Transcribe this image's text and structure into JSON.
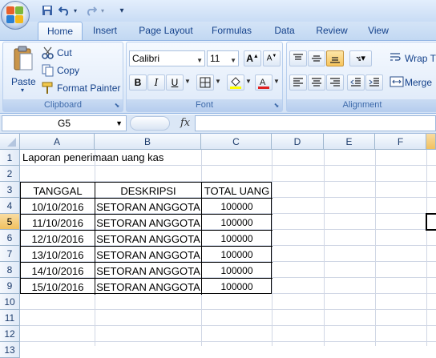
{
  "qat": {
    "save_icon": "save-icon",
    "undo_icon": "undo-icon",
    "redo_icon": "redo-icon",
    "customize_icon": "customize-qat-icon"
  },
  "tabs": [
    "Home",
    "Insert",
    "Page Layout",
    "Formulas",
    "Data",
    "Review",
    "View"
  ],
  "ribbon": {
    "clipboard": {
      "label": "Clipboard",
      "paste": "Paste",
      "cut": "Cut",
      "copy": "Copy",
      "format_painter": "Format Painter"
    },
    "font": {
      "label": "Font",
      "font_name": "Calibri",
      "font_size": "11",
      "bold": "B",
      "italic": "I",
      "underline": "U"
    },
    "alignment": {
      "label": "Alignment",
      "wrap": "Wrap T",
      "merge": "Merge"
    }
  },
  "formula_bar": {
    "name_box": "G5",
    "fx": "fx",
    "value": ""
  },
  "columns": [
    "A",
    "B",
    "C",
    "D",
    "E",
    "F"
  ],
  "rows": [
    "1",
    "2",
    "3",
    "4",
    "5",
    "6",
    "7",
    "8",
    "9",
    "10",
    "11",
    "12",
    "13"
  ],
  "selected": {
    "row": "5",
    "column": "G"
  },
  "sheet": {
    "title": "Laporan penerimaan uang kas",
    "headers": [
      "TANGGAL",
      "DESKRIPSI",
      "TOTAL UANG"
    ],
    "records": [
      [
        "10/10/2016",
        "SETORAN ANGGOTA",
        "100000"
      ],
      [
        "11/10/2016",
        "SETORAN ANGGOTA",
        "100000"
      ],
      [
        "12/10/2016",
        "SETORAN ANGGOTA",
        "100000"
      ],
      [
        "13/10/2016",
        "SETORAN ANGGOTA",
        "100000"
      ],
      [
        "14/10/2016",
        "SETORAN ANGGOTA",
        "100000"
      ],
      [
        "15/10/2016",
        "SETORAN ANGGOTA",
        "100000"
      ]
    ]
  },
  "colors": {
    "accent": "#15428b",
    "selected_header": "#f1c15f",
    "gridline": "#d0d7e5"
  }
}
